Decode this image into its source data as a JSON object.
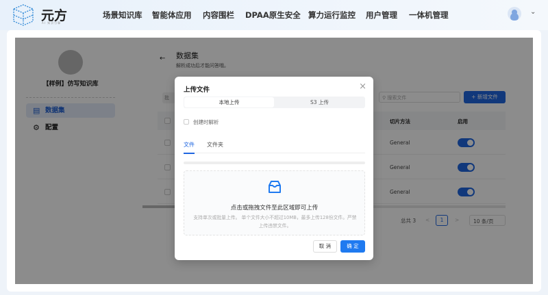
{
  "header": {
    "brand": "元方",
    "brand_sub": "AI 知识引擎",
    "nav": [
      "场景知识库",
      "智能体应用",
      "内容围栏",
      "DPAA原生安全",
      "算力运行监控",
      "用户管理",
      "一体机管理"
    ]
  },
  "sidebar": {
    "kb_title": "【样例】仿写知识库",
    "items": [
      {
        "label": "数据集",
        "icon": "file-text-icon",
        "active": true
      },
      {
        "label": "配置",
        "icon": "gear-icon"
      }
    ]
  },
  "main": {
    "title": "数据集",
    "subtitle": "解析成功后才能问答哦。",
    "batch_label": "批",
    "search_placeholder": "搜索文件",
    "new_file": "新增文件",
    "columns": [
      "切片方法",
      "启用"
    ],
    "rows": [
      {
        "method": "General",
        "enabled": true
      },
      {
        "method": "General",
        "enabled": true
      },
      {
        "method": "General",
        "enabled": true
      }
    ],
    "pagination": {
      "total": "总共 3",
      "page": "1",
      "page_size": "10 条/页"
    }
  },
  "modal": {
    "title": "上传文件",
    "segments": [
      "本地上传",
      "S3 上传"
    ],
    "checkbox": "创建时解析",
    "tabs": [
      "文件",
      "文件夹"
    ],
    "drop_main": "点击或拖拽文件至此区域即可上传",
    "drop_hint": "支持单次或批量上传。 单个文件大小不超过10MB，最多上传128份文件。严禁上传违禁文件。",
    "cancel": "取 消",
    "ok": "确 定"
  },
  "colors": {
    "accent": "#1f66e0"
  }
}
